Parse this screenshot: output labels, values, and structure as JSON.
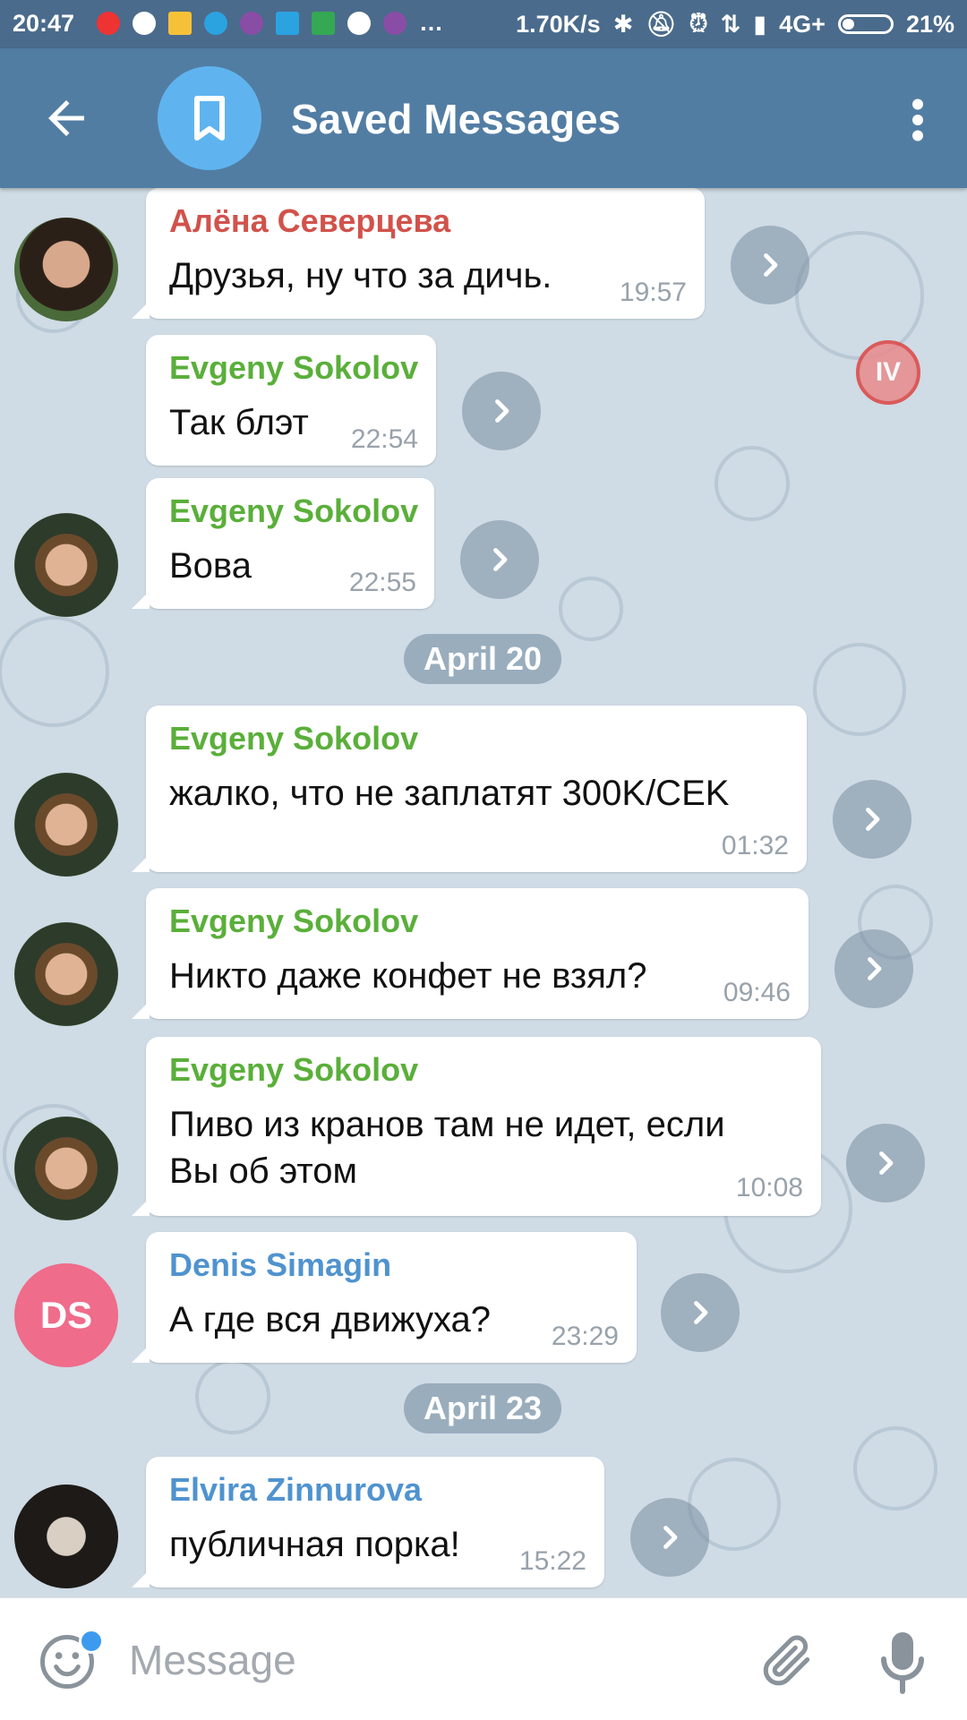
{
  "status_bar": {
    "time": "20:47",
    "network_speed": "1.70K/s",
    "network_type": "4G+",
    "battery": "21%"
  },
  "header": {
    "title": "Saved Messages",
    "back_icon": "arrow-left-icon",
    "avatar_icon": "bookmark-icon",
    "menu_icon": "more-vertical-icon"
  },
  "messages": [
    {
      "sender": "Алёна Северцева",
      "sender_color": "#d1524b",
      "text": "Друзья, ну что за дичь.",
      "time": "19:57"
    },
    {
      "sender": "Evgeny Sokolov",
      "sender_color": "#5aaf3a",
      "text": "Так блэт",
      "time": "22:54"
    },
    {
      "sender": "Evgeny Sokolov",
      "sender_color": "#5aaf3a",
      "text": "Вова",
      "time": "22:55"
    },
    {
      "sender": "Evgeny Sokolov",
      "sender_color": "#5aaf3a",
      "text": "жалко, что не заплатят 300K/CEK",
      "time": "01:32"
    },
    {
      "sender": "Evgeny Sokolov",
      "sender_color": "#5aaf3a",
      "text": "Никто даже конфет не взял?",
      "time": "09:46"
    },
    {
      "sender": "Evgeny Sokolov",
      "sender_color": "#5aaf3a",
      "text_line1": "Пиво из кранов там не идет, если",
      "text_line2": "Вы об этом",
      "time": "10:08"
    },
    {
      "sender": "Denis Simagin",
      "sender_color": "#4f93cf",
      "text": "А где вся движуха?",
      "time": "23:29",
      "avatar_initials": "DS"
    },
    {
      "sender": "Elvira Zinnurova",
      "sender_color": "#4f93cf",
      "text": "публичная порка!",
      "time": "15:22"
    }
  ],
  "dates": [
    "April 20",
    "April 23"
  ],
  "input": {
    "placeholder": "Message",
    "emoji_icon": "smile-icon",
    "attach_icon": "paperclip-icon",
    "mic_icon": "microphone-icon"
  },
  "overlay_badge": "IV"
}
